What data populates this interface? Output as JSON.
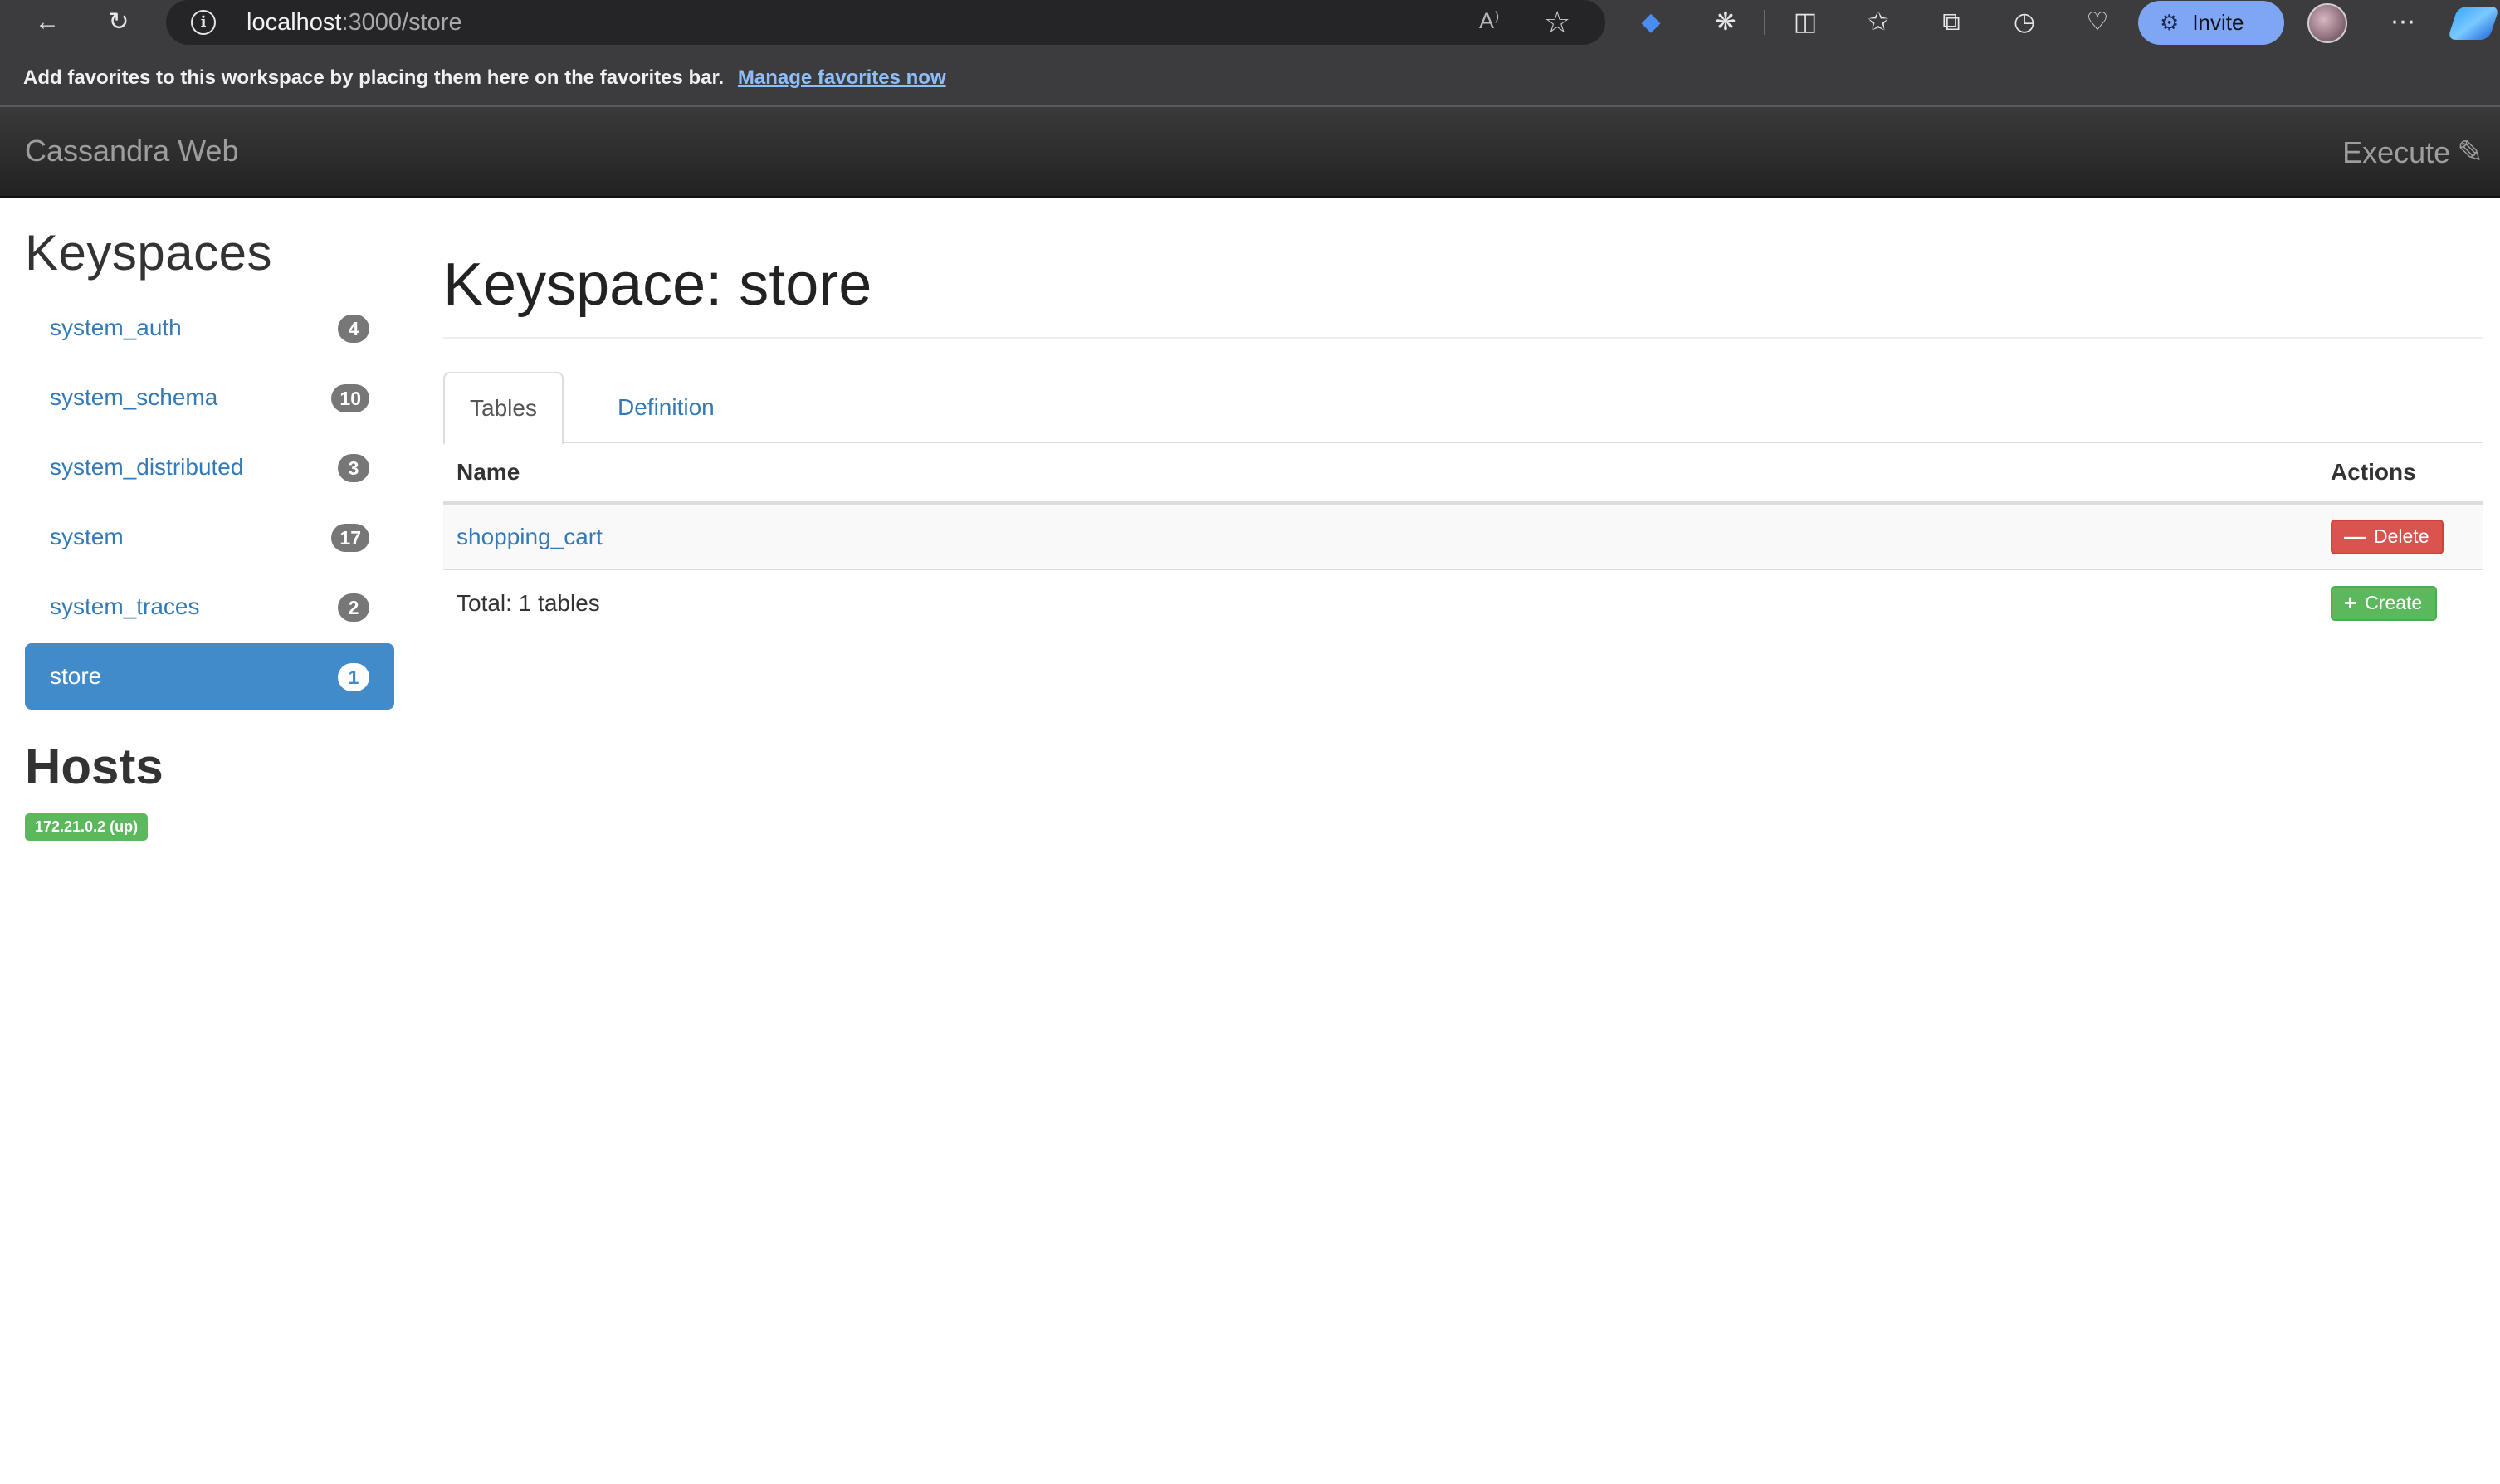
{
  "browser": {
    "url_host": "localhost",
    "url_path": ":3000/store",
    "read_aloud_icon": "A⁾",
    "invite_label": "Invite",
    "favorites_bar_text": "Add favorites to this workspace by placing them here on the favorites bar.",
    "favorites_link": "Manage favorites now"
  },
  "navbar": {
    "brand": "Cassandra Web",
    "execute_label": "Execute"
  },
  "sidebar": {
    "keyspaces_heading": "Keyspaces",
    "keyspaces": [
      {
        "name": "system_auth",
        "count": "4"
      },
      {
        "name": "system_schema",
        "count": "10"
      },
      {
        "name": "system_distributed",
        "count": "3"
      },
      {
        "name": "system",
        "count": "17"
      },
      {
        "name": "system_traces",
        "count": "2"
      },
      {
        "name": "store",
        "count": "1",
        "active": true
      }
    ],
    "hosts_heading": "Hosts",
    "hosts": [
      {
        "label": "172.21.0.2 (up)",
        "status_color": "#5cb85c"
      }
    ]
  },
  "main": {
    "title": "Keyspace: store",
    "tabs": [
      {
        "label": "Tables",
        "active": true
      },
      {
        "label": "Definition",
        "active": false
      }
    ],
    "table": {
      "headers": {
        "name": "Name",
        "actions": "Actions"
      },
      "rows": [
        {
          "name": "shopping_cart",
          "action_label": "Delete"
        }
      ],
      "footer_text": "Total: 1 tables",
      "create_label": "Create"
    }
  },
  "colors": {
    "link": "#337ab7",
    "active_item": "#428bca",
    "danger": "#d9534f",
    "success": "#5cb85c"
  }
}
